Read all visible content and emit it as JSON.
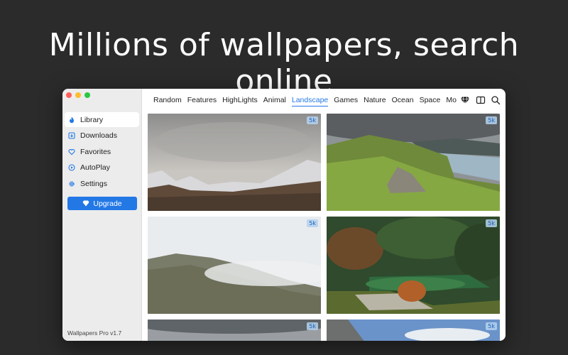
{
  "headline": "Millions of wallpapers, search online",
  "sidebar": {
    "items": [
      {
        "label": "Library",
        "icon": "flame-icon",
        "active": true
      },
      {
        "label": "Downloads",
        "icon": "download-icon",
        "active": false
      },
      {
        "label": "Favorites",
        "icon": "heart-icon",
        "active": false
      },
      {
        "label": "AutoPlay",
        "icon": "play-icon",
        "active": false
      },
      {
        "label": "Settings",
        "icon": "gear-icon",
        "active": false
      }
    ],
    "upgrade_label": "Upgrade",
    "version": "Wallpapers Pro v1.7"
  },
  "tabs": [
    "Random",
    "Features",
    "HighLights",
    "Animal",
    "Landscape",
    "Games",
    "Nature",
    "Ocean",
    "Space",
    "Mountai"
  ],
  "active_tab": "Landscape",
  "tiles": [
    {
      "badge": "5k"
    },
    {
      "badge": "5k"
    },
    {
      "badge": "5k"
    },
    {
      "badge": "5k"
    },
    {
      "badge": "5k"
    },
    {
      "badge": "5k"
    }
  ],
  "colors": {
    "accent": "#2378e6",
    "background": "#2b2b2b"
  }
}
